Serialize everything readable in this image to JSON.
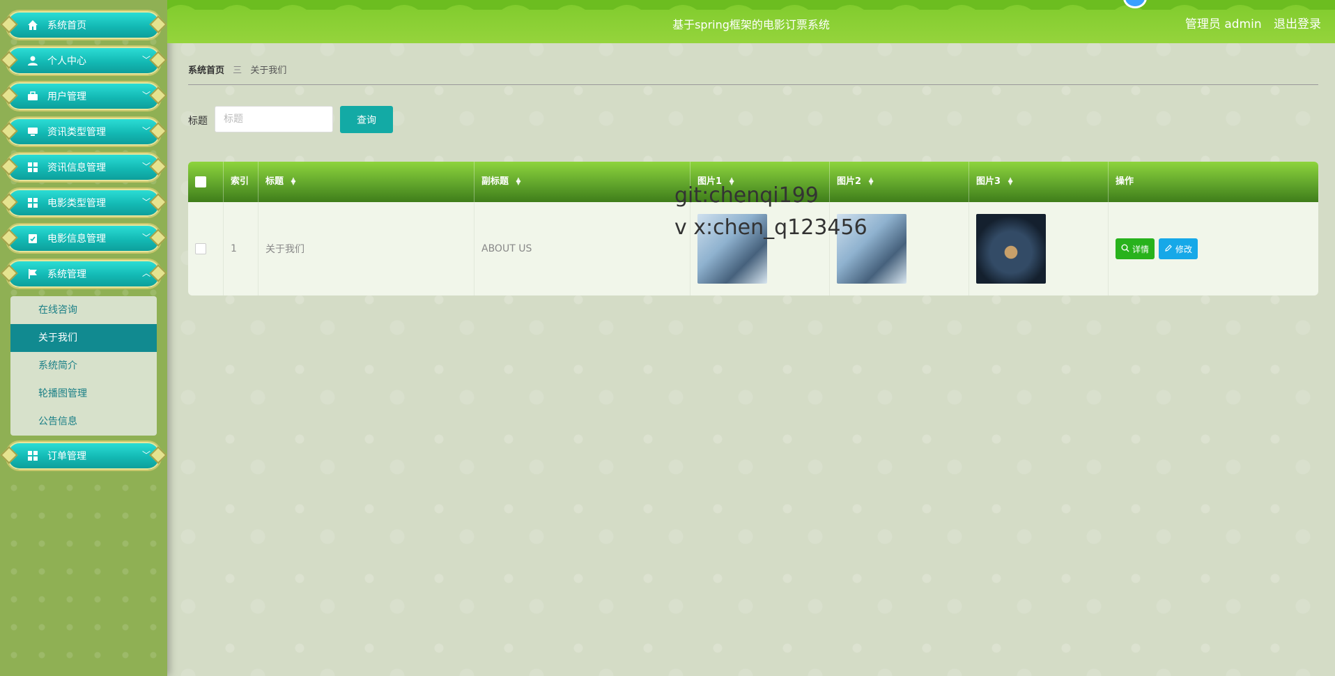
{
  "header": {
    "title": "基于spring框架的电影订票系统",
    "user_label": "管理员 admin",
    "logout_label": "退出登录"
  },
  "sidebar": {
    "items": [
      {
        "label": "系统首页",
        "icon": "home-icon"
      },
      {
        "label": "个人中心",
        "icon": "user-icon"
      },
      {
        "label": "用户管理",
        "icon": "briefcase-icon"
      },
      {
        "label": "资讯类型管理",
        "icon": "monitor-icon"
      },
      {
        "label": "资讯信息管理",
        "icon": "grid-icon"
      },
      {
        "label": "电影类型管理",
        "icon": "grid-icon"
      },
      {
        "label": "电影信息管理",
        "icon": "clipboard-icon"
      },
      {
        "label": "系统管理",
        "icon": "flag-icon"
      },
      {
        "label": "订单管理",
        "icon": "grid-icon"
      }
    ],
    "submenu": [
      "在线咨询",
      "关于我们",
      "系统简介",
      "轮播图管理",
      "公告信息"
    ]
  },
  "breadcrumb": {
    "home": "系统首页",
    "separator": "三",
    "current": "关于我们"
  },
  "search": {
    "label": "标题",
    "placeholder": "标题",
    "button": "查询"
  },
  "table": {
    "headers": [
      "索引",
      "标题",
      "副标题",
      "图片1",
      "图片2",
      "图片3",
      "操作"
    ],
    "rows": [
      {
        "index": "1",
        "title": "关于我们",
        "subtitle": "ABOUT US"
      }
    ],
    "buttons": {
      "detail": "详情",
      "edit": "修改"
    }
  },
  "watermark": {
    "line1": "git:chenqi199",
    "line2": "v x:chen_q123456"
  },
  "colors": {
    "header": "#8ccf36",
    "accent": "#13aaa5",
    "detail_btn": "#28b21c",
    "edit_btn": "#16a8e8"
  }
}
